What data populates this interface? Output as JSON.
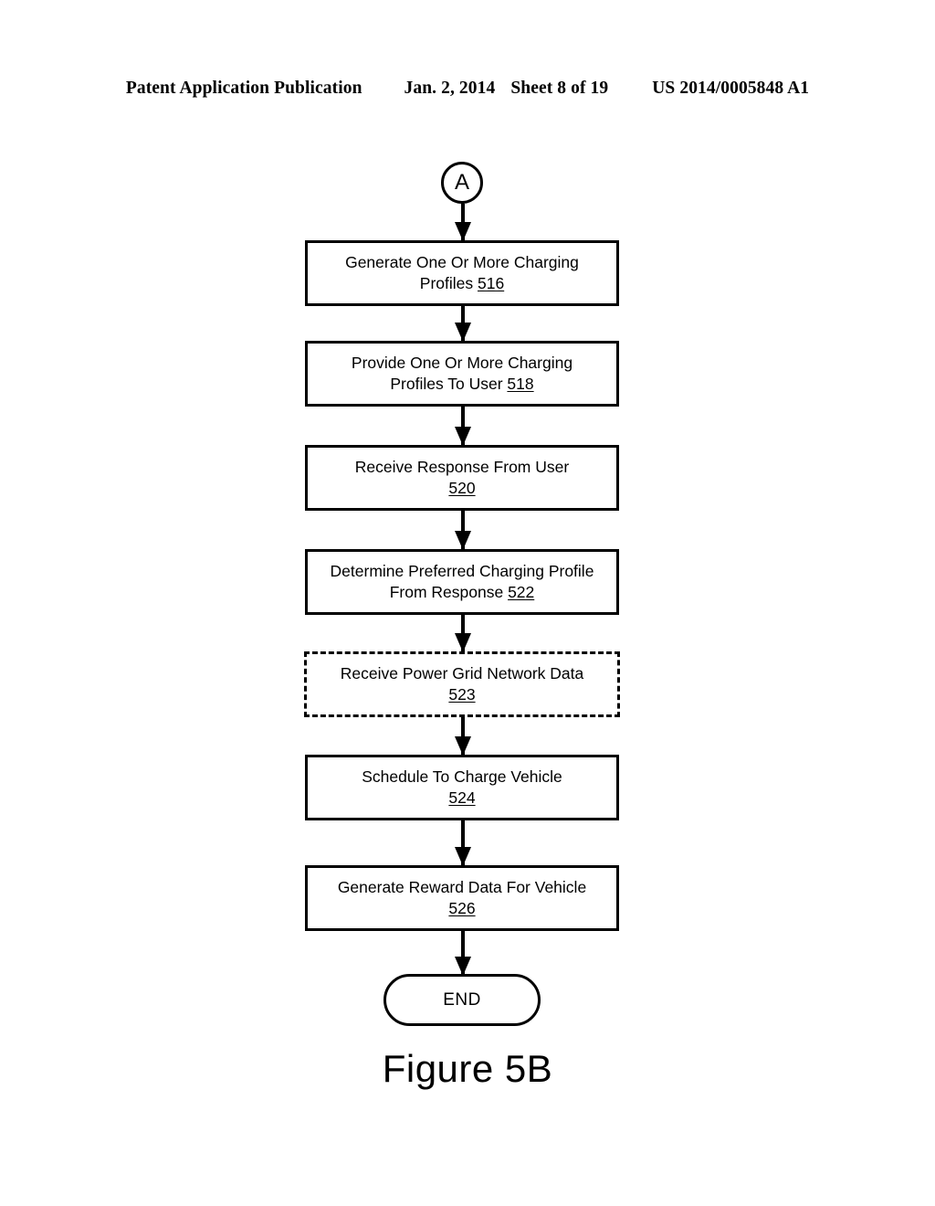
{
  "header": {
    "publication": "Patent Application Publication",
    "date": "Jan. 2, 2014",
    "sheet": "Sheet 8 of 19",
    "patent_number": "US 2014/0005848 A1"
  },
  "figure": {
    "caption": "Figure 5B"
  },
  "flowchart": {
    "connector": {
      "label": "A"
    },
    "nodes": [
      {
        "id": "node-516",
        "line1": "Generate One Or More Charging",
        "line2": "Profiles ",
        "ref": "516",
        "shape": "rectangle",
        "border": "solid"
      },
      {
        "id": "node-518",
        "line1": "Provide One Or More Charging",
        "line2": "Profiles To User ",
        "ref": "518",
        "shape": "rectangle",
        "border": "solid"
      },
      {
        "id": "node-520",
        "line1": "Receive Response From User",
        "line2": "",
        "ref": "520",
        "shape": "rectangle",
        "border": "solid"
      },
      {
        "id": "node-522",
        "line1": "Determine Preferred Charging Profile",
        "line2": "From Response ",
        "ref": "522",
        "shape": "rectangle",
        "border": "solid"
      },
      {
        "id": "node-523",
        "line1": "Receive Power Grid Network Data",
        "line2": "",
        "ref": "523",
        "shape": "rectangle",
        "border": "dashed"
      },
      {
        "id": "node-524",
        "line1": "Schedule To Charge Vehicle",
        "line2": "",
        "ref": "524",
        "shape": "rectangle",
        "border": "solid"
      },
      {
        "id": "node-526",
        "line1": "Generate Reward Data For Vehicle",
        "line2": "",
        "ref": "526",
        "shape": "rectangle",
        "border": "solid"
      }
    ],
    "terminal": {
      "label": "END",
      "shape": "stadium"
    }
  },
  "colors": {
    "ink": "#000000",
    "paper": "#ffffff"
  }
}
